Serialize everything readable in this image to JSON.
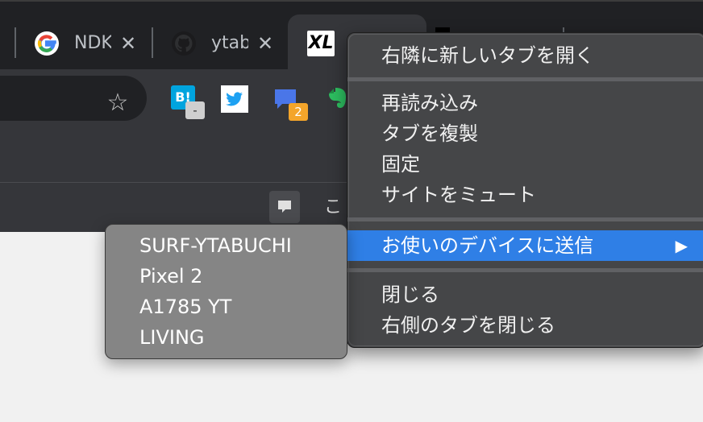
{
  "tabs": [
    {
      "title": "NDK",
      "close": "✕",
      "icon": "google-icon"
    },
    {
      "title": "ytab",
      "close": "✕",
      "icon": "github-icon"
    },
    {
      "title": "XL",
      "icon": "xl-icon"
    }
  ],
  "toolbar": {
    "star": "☆",
    "extensions": [
      {
        "icon": "hatena-bookmark-icon",
        "label": "B!",
        "badge": "-"
      },
      {
        "icon": "twitter-icon"
      },
      {
        "icon": "chat-extension-icon",
        "badge": "2"
      },
      {
        "icon": "evernote-icon"
      }
    ]
  },
  "infobar": {
    "glyph": "こ"
  },
  "context_menu": {
    "items": [
      {
        "label": "右隣に新しいタブを開く"
      },
      {
        "label": "再読み込み"
      },
      {
        "label": "タブを複製"
      },
      {
        "label": "固定"
      },
      {
        "label": "サイトをミュート"
      },
      {
        "label": "お使いのデバイスに送信",
        "arrow": "▶",
        "selected": true
      },
      {
        "label": "閉じる"
      },
      {
        "label": "右側のタブを閉じる"
      }
    ]
  },
  "submenu": {
    "items": [
      {
        "label": "SURF-YTABUCHI"
      },
      {
        "label": "Pixel 2"
      },
      {
        "label": "A1785 YT"
      },
      {
        "label": "LIVING"
      }
    ]
  },
  "colors": {
    "menu_bg": "#454648",
    "menu_selected": "#2f7fe6",
    "submenu_bg": "#858585",
    "chrome_dark": "#202124",
    "chrome_toolbar": "#35363a"
  }
}
